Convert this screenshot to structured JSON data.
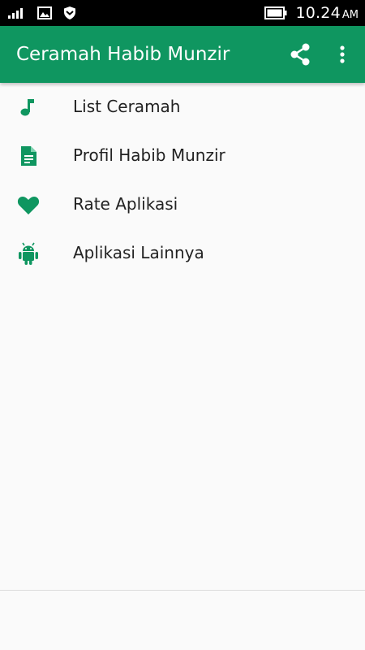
{
  "status_bar": {
    "time": "10.24",
    "ampm": "AM",
    "icons": [
      "signal-icon",
      "image-icon",
      "shield-icon",
      "battery-icon"
    ]
  },
  "app_bar": {
    "title": "Ceramah Habib Munzir",
    "actions": [
      "share-icon",
      "more-vert-icon"
    ],
    "color": "#0f9660"
  },
  "menu": {
    "items": [
      {
        "label": "List Ceramah",
        "icon": "music-note-icon"
      },
      {
        "label": "Profil Habib Munzir",
        "icon": "document-icon"
      },
      {
        "label": "Rate Aplikasi",
        "icon": "heart-icon"
      },
      {
        "label": "Aplikasi Lainnya",
        "icon": "android-icon"
      }
    ],
    "icon_color": "#0f9660"
  }
}
